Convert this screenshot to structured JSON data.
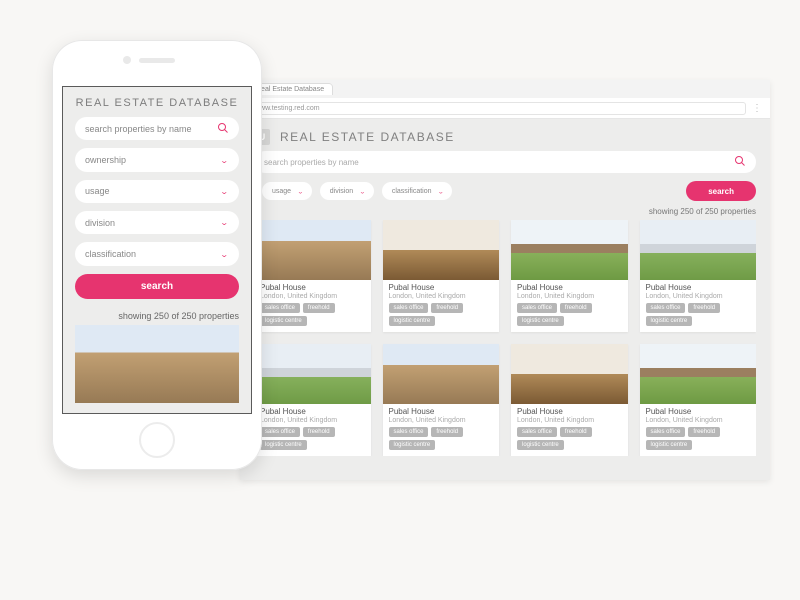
{
  "app_title": "REAL ESTATE DATABASE",
  "browser": {
    "tab_label": "Real Estate Database",
    "url": "www.testing.red.com"
  },
  "search": {
    "placeholder": "search properties by name",
    "button_label": "search"
  },
  "filters": {
    "ownership": "ownership",
    "usage": "usage",
    "division": "division",
    "classification": "classification"
  },
  "results": {
    "count_text": "showing 250 of 250 properties"
  },
  "card": {
    "title": "Pubal House",
    "location": "London, United Kingdom",
    "tags": [
      "sales office",
      "freehold",
      "logistic centre"
    ]
  }
}
